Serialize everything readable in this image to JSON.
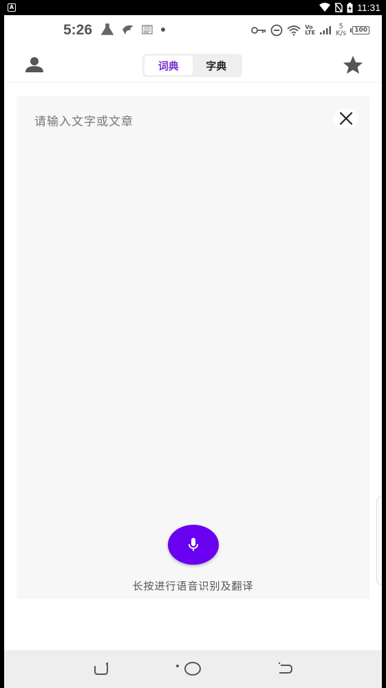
{
  "system_status": {
    "a_label": "A",
    "time": "11:31"
  },
  "inner_status": {
    "time": "5:26",
    "net_speed_top": "5",
    "net_speed_bottom": "K/s",
    "volte_top": "Vo",
    "volte_bottom": "LTE",
    "battery": "100"
  },
  "app_bar": {
    "tabs": [
      {
        "label": "词典",
        "active": true
      },
      {
        "label": "字典",
        "active": false
      }
    ]
  },
  "input": {
    "placeholder": "请输入文字或文章"
  },
  "voice": {
    "hint": "长按进行语音识别及翻译"
  },
  "colors": {
    "accent": "#7b2fd6",
    "mic": "#6a00f0"
  }
}
